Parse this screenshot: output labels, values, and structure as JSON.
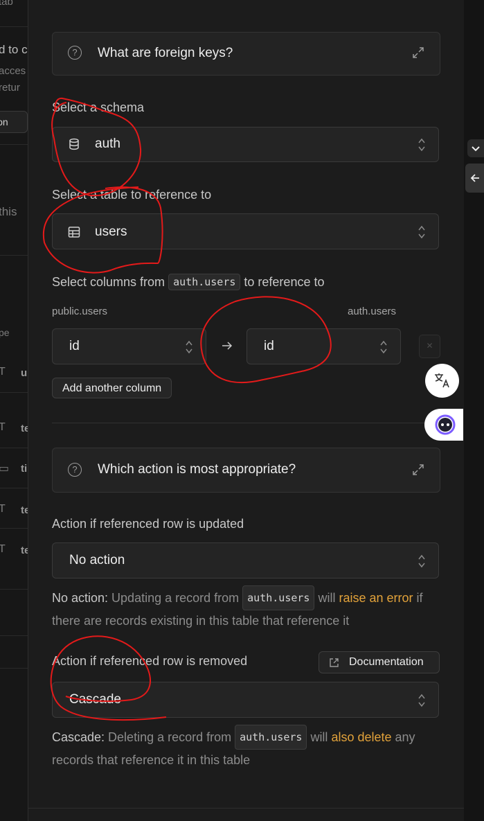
{
  "background": {
    "fragments": [
      "tab",
      "d to c",
      "acces",
      "retur",
      "ion",
      "this",
      "pe",
      "u",
      "te",
      "ti",
      "te",
      "te"
    ]
  },
  "info_foreign_keys": {
    "title": "What are foreign keys?"
  },
  "schema": {
    "label": "Select a schema",
    "value": "auth"
  },
  "table": {
    "label": "Select a table to reference to",
    "value": "users"
  },
  "columns": {
    "label_before": "Select columns from",
    "label_code": "auth.users",
    "label_after": "to reference to",
    "source_table": "public.users",
    "target_table": "auth.users",
    "source_value": "id",
    "target_value": "id",
    "add_button": "Add another column"
  },
  "info_actions": {
    "title": "Which action is most appropriate?"
  },
  "on_update": {
    "label": "Action if referenced row is updated",
    "value": "No action",
    "desc_lead": "No action:",
    "desc_1": " Updating a record from ",
    "desc_code": "auth.users",
    "desc_2": " will ",
    "desc_warn": "raise an error",
    "desc_3": " if there are records existing in this table that reference it"
  },
  "on_delete": {
    "label": "Action if referenced row is removed",
    "doc_button": "Documentation",
    "value": "Cascade",
    "desc_lead": "Cascade:",
    "desc_1": " Deleting a record from ",
    "desc_code": "auth.users",
    "desc_2": " will ",
    "desc_warn": "also delete",
    "desc_3": " any records that reference it in this table"
  },
  "colors": {
    "accent_warning": "#e2a23a",
    "annotation": "#e41a1a"
  }
}
